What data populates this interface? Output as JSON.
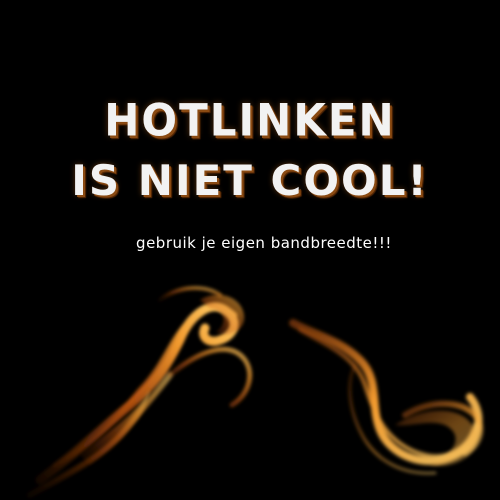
{
  "image": {
    "background_color": "#000000",
    "headline_line1": "HOTLINKEN",
    "headline_line2": "IS NIET COOL!",
    "tagline": "gebruik je eigen bandbreedte!!!",
    "flame_colors": [
      "#ffcf6a",
      "#f29a2e",
      "#c85a12",
      "#6a2a06"
    ]
  }
}
